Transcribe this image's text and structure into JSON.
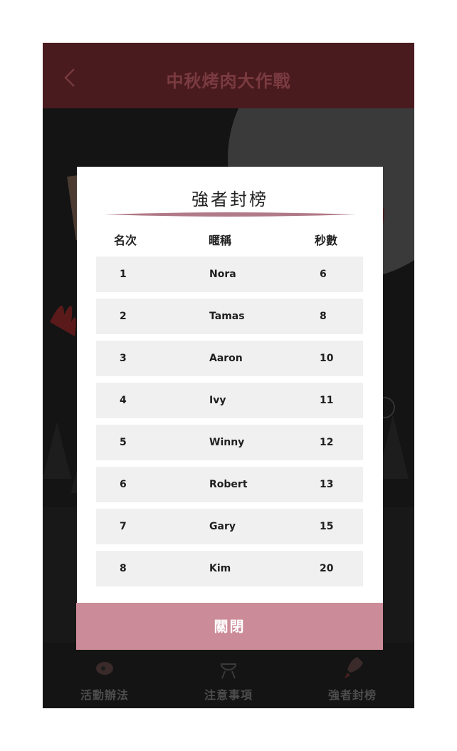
{
  "header": {
    "title": "中秋烤肉大作戰"
  },
  "bottom_nav": [
    {
      "label": "活動辦法",
      "icon": "meat-icon"
    },
    {
      "label": "注意事項",
      "icon": "grill-icon"
    },
    {
      "label": "強者封榜",
      "icon": "rocket-icon"
    }
  ],
  "leaderboard": {
    "title": "強者封榜",
    "columns": {
      "rank": "名次",
      "name": "暱稱",
      "seconds": "秒數"
    },
    "rows": [
      {
        "rank": "1",
        "name": "Nora",
        "seconds": "6"
      },
      {
        "rank": "2",
        "name": "Tamas",
        "seconds": "8"
      },
      {
        "rank": "3",
        "name": "Aaron",
        "seconds": "10"
      },
      {
        "rank": "4",
        "name": "Ivy",
        "seconds": "11"
      },
      {
        "rank": "5",
        "name": "Winny",
        "seconds": "12"
      },
      {
        "rank": "6",
        "name": "Robert",
        "seconds": "13"
      },
      {
        "rank": "7",
        "name": "Gary",
        "seconds": "15"
      },
      {
        "rank": "8",
        "name": "Kim",
        "seconds": "20"
      }
    ],
    "close_label": "關閉"
  },
  "colors": {
    "header_bg": "#4a1b1e",
    "accent": "#cc8b98",
    "row_bg": "#f0f0f0"
  }
}
